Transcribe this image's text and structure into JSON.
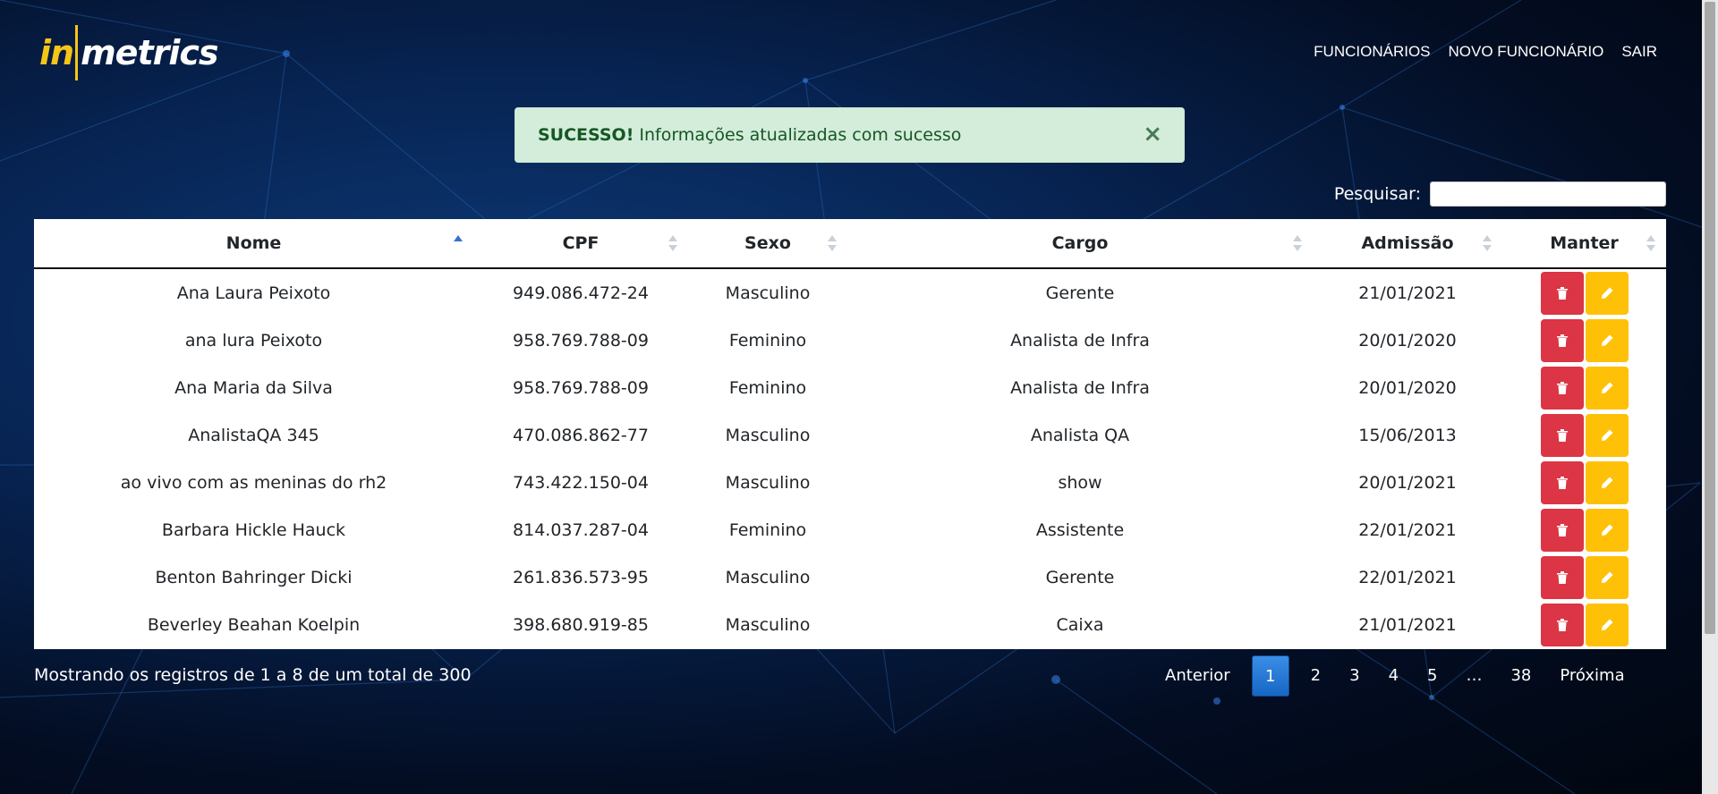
{
  "brand": {
    "logo_left": "in",
    "logo_right": "metrics"
  },
  "nav": {
    "items": [
      "FUNCIONÁRIOS",
      "NOVO FUNCIONÁRIO",
      "SAIR"
    ]
  },
  "alert": {
    "strong": "SUCESSO!",
    "message": "Informações atualizadas com sucesso",
    "close": "×"
  },
  "search": {
    "label": "Pesquisar:",
    "value": ""
  },
  "table": {
    "headers": [
      "Nome",
      "CPF",
      "Sexo",
      "Cargo",
      "Admissão",
      "Manter"
    ],
    "sorted_column": "Nome",
    "rows": [
      [
        "Ana Laura Peixoto",
        "949.086.472-24",
        "Masculino",
        "Gerente",
        "21/01/2021"
      ],
      [
        "ana lura Peixoto",
        "958.769.788-09",
        "Feminino",
        "Analista de Infra",
        "20/01/2020"
      ],
      [
        "Ana Maria da Silva",
        "958.769.788-09",
        "Feminino",
        "Analista de Infra",
        "20/01/2020"
      ],
      [
        "AnalistaQA 345",
        "470.086.862-77",
        "Masculino",
        "Analista QA",
        "15/06/2013"
      ],
      [
        "ao vivo com as meninas do rh2",
        "743.422.150-04",
        "Masculino",
        "show",
        "20/01/2021"
      ],
      [
        "Barbara Hickle Hauck",
        "814.037.287-04",
        "Feminino",
        "Assistente",
        "22/01/2021"
      ],
      [
        "Benton Bahringer Dicki",
        "261.836.573-95",
        "Masculino",
        "Gerente",
        "22/01/2021"
      ],
      [
        "Beverley Beahan Koelpin",
        "398.680.919-85",
        "Masculino",
        "Caixa",
        "21/01/2021"
      ]
    ]
  },
  "footer": {
    "info": "Mostrando os registros de 1 a 8 de um total de 300"
  },
  "pagination": {
    "prev": "Anterior",
    "pages": [
      "1",
      "2",
      "3",
      "4",
      "5",
      "…",
      "38"
    ],
    "active": "1",
    "next": "Próxima"
  },
  "colors": {
    "delete": "#dc3545",
    "edit": "#ffc107",
    "alert_bg": "#d4edda",
    "accent": "#f5c518"
  }
}
